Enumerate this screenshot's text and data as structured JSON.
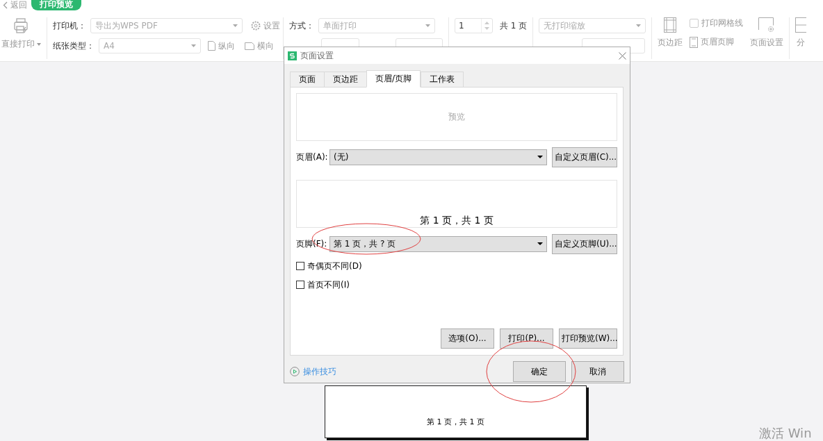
{
  "top_bar": {
    "back": "返回",
    "title": "打印预览"
  },
  "toolbar": {
    "direct_print": "直接打印",
    "printer_label": "打印机：",
    "printer": "导出为WPS PDF",
    "settings": "设置",
    "paper_label": "纸张类型：",
    "paper": "A4",
    "portrait": "纵向",
    "landscape": "横向",
    "mode_label": "方式：",
    "mode": "单面打印",
    "page": "1",
    "total": "共 1 页",
    "scale_mode": "无打印缩放",
    "margins": "页边距",
    "gridlines": {
      "label": "打印网格线",
      "checked": false
    },
    "header_footer": "页眉页脚",
    "page_setup": "页面设置",
    "page_break": "分"
  },
  "dialog": {
    "title": "页面设置",
    "tabs": [
      {
        "label": "页面",
        "selected": false
      },
      {
        "label": "页边距",
        "selected": false
      },
      {
        "label": "页眉/页脚",
        "selected": true
      },
      {
        "label": "工作表",
        "selected": false
      }
    ],
    "header_preview": "预览",
    "header_label": "页眉(A):",
    "header_value": "(无)",
    "header_button": "自定义页眉(C)...",
    "footer_preview": "第 1 页，共 1 页",
    "footer_label": "页脚(F):",
    "footer_value": "第 1 页，共 ? 页",
    "footer_button": "自定义页脚(U)...",
    "checkboxes": [
      {
        "label": "奇偶页不同(D)",
        "checked": false
      },
      {
        "label": "首页不同(I)",
        "checked": false
      }
    ],
    "buttons": [
      "选项(O)...",
      "打印(P)...",
      "打印预览(W)..."
    ],
    "tips": "操作技巧",
    "ok": "确定",
    "cancel": "取消"
  },
  "page_preview": {
    "footer": "第 1 页，共 1 页"
  },
  "activation_notice": "激活 Win"
}
